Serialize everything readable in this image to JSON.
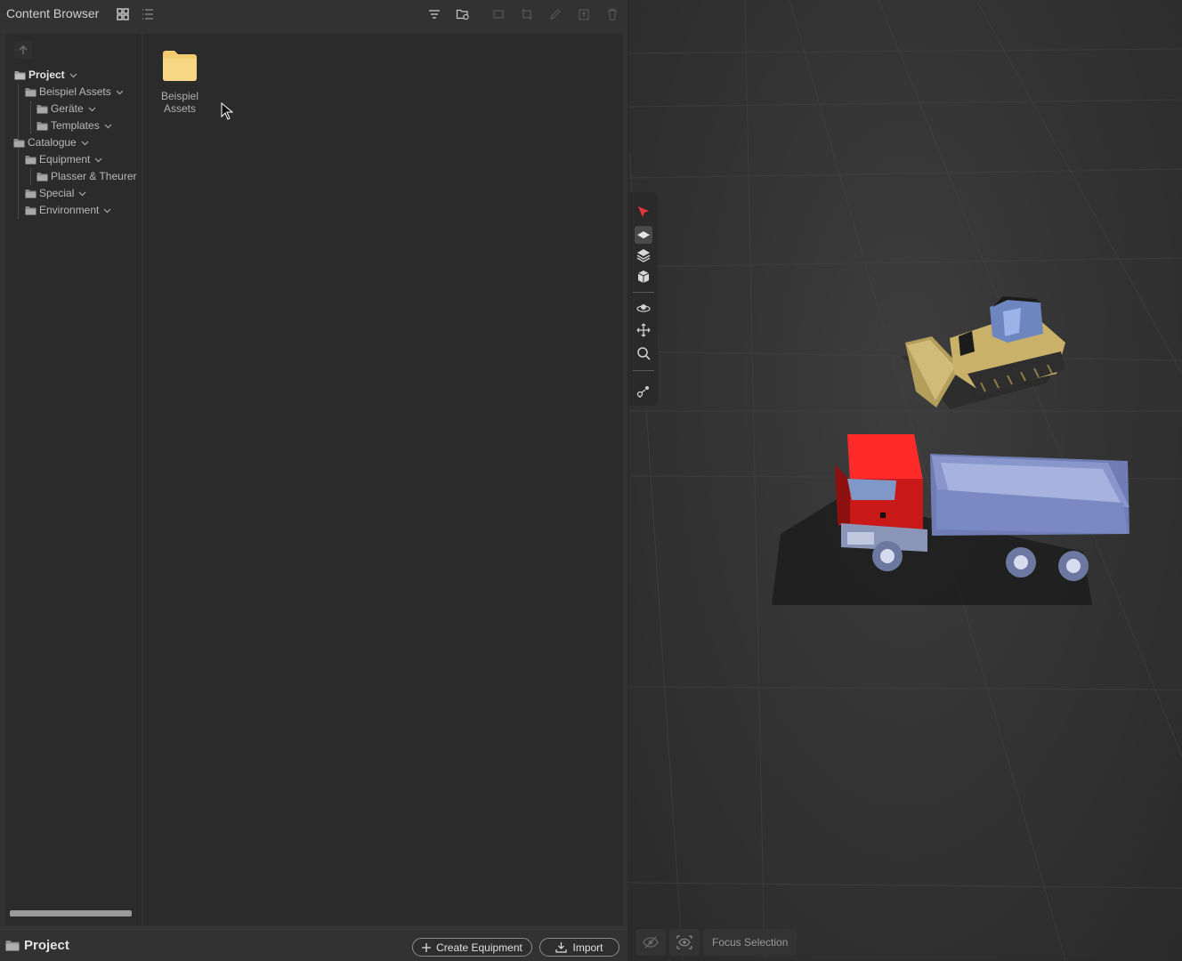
{
  "header": {
    "title": "Content Browser",
    "view_icons": [
      "grid-view-icon",
      "list-view-icon"
    ],
    "action_icons": [
      "filter-icon",
      "folder-settings-icon",
      "frame-icon",
      "crop-icon",
      "edit-icon",
      "upload-icon",
      "trash-icon"
    ]
  },
  "tree": {
    "items": [
      {
        "label": "Project",
        "bold": true
      },
      {
        "label": "Beispiel Assets"
      },
      {
        "label": "Geräte"
      },
      {
        "label": "Templates"
      },
      {
        "label": "Catalogue"
      },
      {
        "label": "Equipment"
      },
      {
        "label": "Plasser & Theurer"
      },
      {
        "label": "Special"
      },
      {
        "label": "Environment"
      }
    ]
  },
  "content": {
    "items": [
      {
        "label_line1": "Beispiel",
        "label_line2": "Assets"
      }
    ]
  },
  "footer": {
    "breadcrumb": "Project",
    "create_label": "Create Equipment",
    "import_label": "Import"
  },
  "viewport": {
    "tools": [
      "select-icon",
      "plane-icon",
      "layers-icon",
      "cube-icon",
      "orbit-icon",
      "move-icon",
      "zoom-icon",
      "path-icon"
    ],
    "hide_icon": "eye-off-icon",
    "show_icon": "eye-icon",
    "focus_label": "Focus Selection",
    "colors": {
      "truck_cab": "#e02020",
      "truck_body": "#7d8bc4",
      "dozer": "#c9b16a"
    }
  }
}
